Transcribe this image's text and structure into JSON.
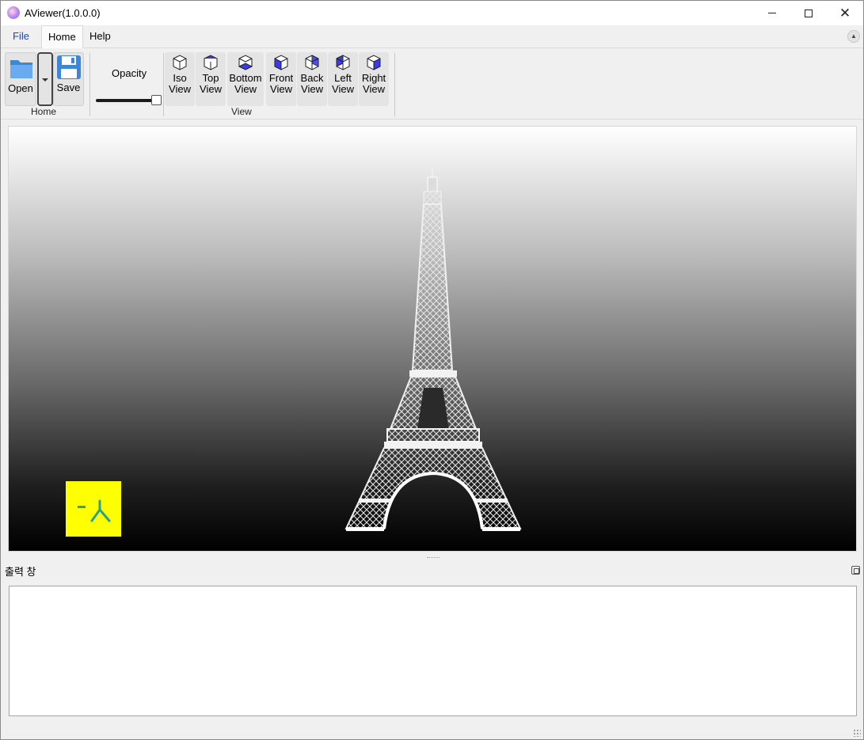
{
  "window": {
    "title": "AViewer(1.0.0.0)",
    "controls": {
      "minimize": "minimize",
      "maximize": "maximize",
      "close": "✕"
    }
  },
  "menu": {
    "tabs": [
      {
        "label": "File",
        "color": "#1a44c8"
      },
      {
        "label": "Home",
        "active": true
      },
      {
        "label": "Help"
      }
    ]
  },
  "ribbon": {
    "home_group": {
      "label": "Home",
      "open_label": "Open",
      "save_label": "Save"
    },
    "opacity": {
      "label": "Opacity",
      "value": 1.0
    },
    "view_group": {
      "label": "View",
      "buttons": [
        {
          "line1": "Iso",
          "line2": "View",
          "icon": "iso-cube-icon"
        },
        {
          "line1": "Top",
          "line2": "View",
          "icon": "top-cube-icon"
        },
        {
          "line1": "Bottom",
          "line2": "View",
          "icon": "bottom-cube-icon"
        },
        {
          "line1": "Front",
          "line2": "View",
          "icon": "front-cube-icon"
        },
        {
          "line1": "Back",
          "line2": "View",
          "icon": "back-cube-icon"
        },
        {
          "line1": "Left",
          "line2": "View",
          "icon": "left-cube-icon"
        },
        {
          "line1": "Right",
          "line2": "View",
          "icon": "right-cube-icon"
        }
      ],
      "face_color": "#3a3af0"
    }
  },
  "viewport": {
    "model": "eiffel-tower",
    "axis_widget_color": "#ffff00"
  },
  "output": {
    "title": "출력 창",
    "content": ""
  }
}
